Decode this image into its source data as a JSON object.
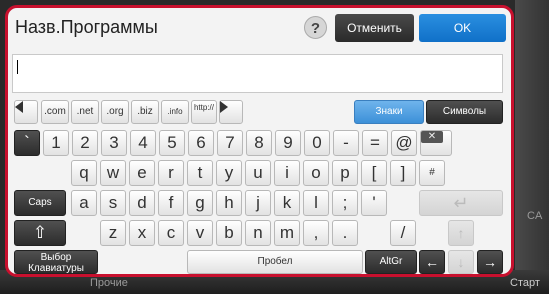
{
  "dialog": {
    "title": "Назв.Программы",
    "help_label": "?",
    "cancel_label": "Отменить",
    "ok_label": "OK"
  },
  "input": {
    "value": ""
  },
  "suffix_row": {
    "items": [
      ".com",
      ".net",
      ".org",
      ".biz",
      ".info",
      "http://"
    ],
    "mode_buttons": {
      "chars": "Знаки",
      "symbols": "Символы"
    }
  },
  "rows": {
    "numbers": [
      "`",
      "1",
      "2",
      "3",
      "4",
      "5",
      "6",
      "7",
      "8",
      "9",
      "0",
      "-",
      "=",
      "@"
    ],
    "qwerty": [
      "q",
      "w",
      "e",
      "r",
      "t",
      "y",
      "u",
      "i",
      "o",
      "p",
      "[",
      "]",
      "#"
    ],
    "asdf": [
      "a",
      "s",
      "d",
      "f",
      "g",
      "h",
      "j",
      "k",
      "l",
      ";",
      "'"
    ],
    "zxcv": [
      "z",
      "x",
      "c",
      "v",
      "b",
      "n",
      "m",
      ",",
      ".",
      "/"
    ]
  },
  "special_keys": {
    "caps": "Caps",
    "layout": "Выбор Клавиатуры",
    "space": "Пробел",
    "altgr": "AltGr"
  },
  "background": {
    "left_label": "Прочие",
    "right_label": "Старт",
    "side_label": "CA"
  },
  "colors": {
    "frame": "#c8102e",
    "ok": "#1070c8",
    "dark_key": "#2c2c2c"
  }
}
